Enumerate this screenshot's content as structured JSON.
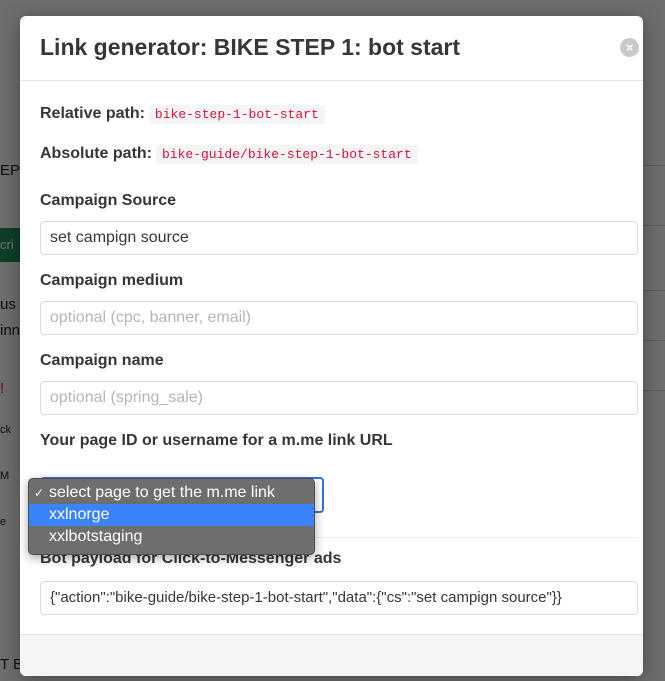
{
  "background": {
    "fragments": [
      "EP",
      "cri",
      "us",
      "inn",
      "!",
      "ck",
      "M",
      "e",
      "T B"
    ]
  },
  "modal": {
    "title": "Link generator: BIKE STEP 1: bot start",
    "close_icon": "×",
    "relative_path": {
      "label": "Relative path:",
      "value": "bike-step-1-bot-start"
    },
    "absolute_path": {
      "label": "Absolute path:",
      "value": "bike-guide/bike-step-1-bot-start"
    },
    "campaign_source": {
      "label": "Campaign Source",
      "value": "set campign source"
    },
    "campaign_medium": {
      "label": "Campaign medium",
      "placeholder": "optional (cpc, banner, email)"
    },
    "campaign_name": {
      "label": "Campaign name",
      "placeholder": "optional (spring_sale)"
    },
    "page_id": {
      "label": "Your page ID or username for a m.me link URL",
      "options": [
        "select page to get the m.me link",
        "xxlnorge",
        "xxlbotstaging"
      ],
      "selected_index": 0,
      "highlighted_index": 1
    },
    "bot_payload": {
      "label": "Bot payload for Click-to-Messenger ads",
      "value": "{\"action\":\"bike-guide/bike-step-1-bot-start\",\"data\":{\"cs\":\"set campign source\"}}"
    }
  },
  "colors": {
    "accent": "#3273dc",
    "code_text": "#da1039",
    "highlight": "#3a84fb",
    "bg_green": "#1f8a5a"
  }
}
